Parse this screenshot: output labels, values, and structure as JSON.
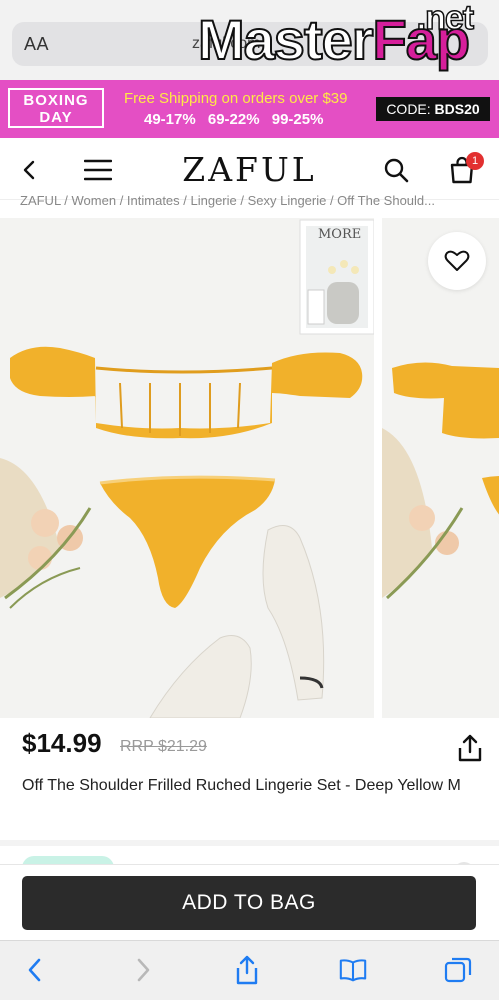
{
  "browser": {
    "text_size_label": "AA",
    "url": "zaful.com",
    "watermark": {
      "part1": "Master",
      "part2": "Fap",
      "suffix": ".net"
    }
  },
  "promo": {
    "badge_line1": "BOXING",
    "badge_line2": "DAY",
    "shipping": "Free Shipping on orders over $39",
    "discounts": "49-17% 69-22% 99-25%",
    "code_label": "CODE:",
    "code_value": "BDS20"
  },
  "header": {
    "logo": "ZAFUL",
    "cart_count": "1"
  },
  "breadcrumb": "ZAFUL / Women / Intimates / Lingerie / Sexy Lingerie / Off The Should...",
  "product": {
    "price": "$14.99",
    "rrp_label": "RRP",
    "rrp_price": "$21.29",
    "title": "Off The Shoulder Frilled Ruched Lingerie Set - Deep Yellow M",
    "inset_caption": "MORE"
  },
  "cta": {
    "add_to_bag": "ADD TO BAG"
  },
  "colors": {
    "promo_bg": "#e44fc4",
    "promo_yellow": "#ffe945",
    "garment": "#f1b12b",
    "cta": "#2b2b2b",
    "safari_blue": "#1f7cf2"
  }
}
